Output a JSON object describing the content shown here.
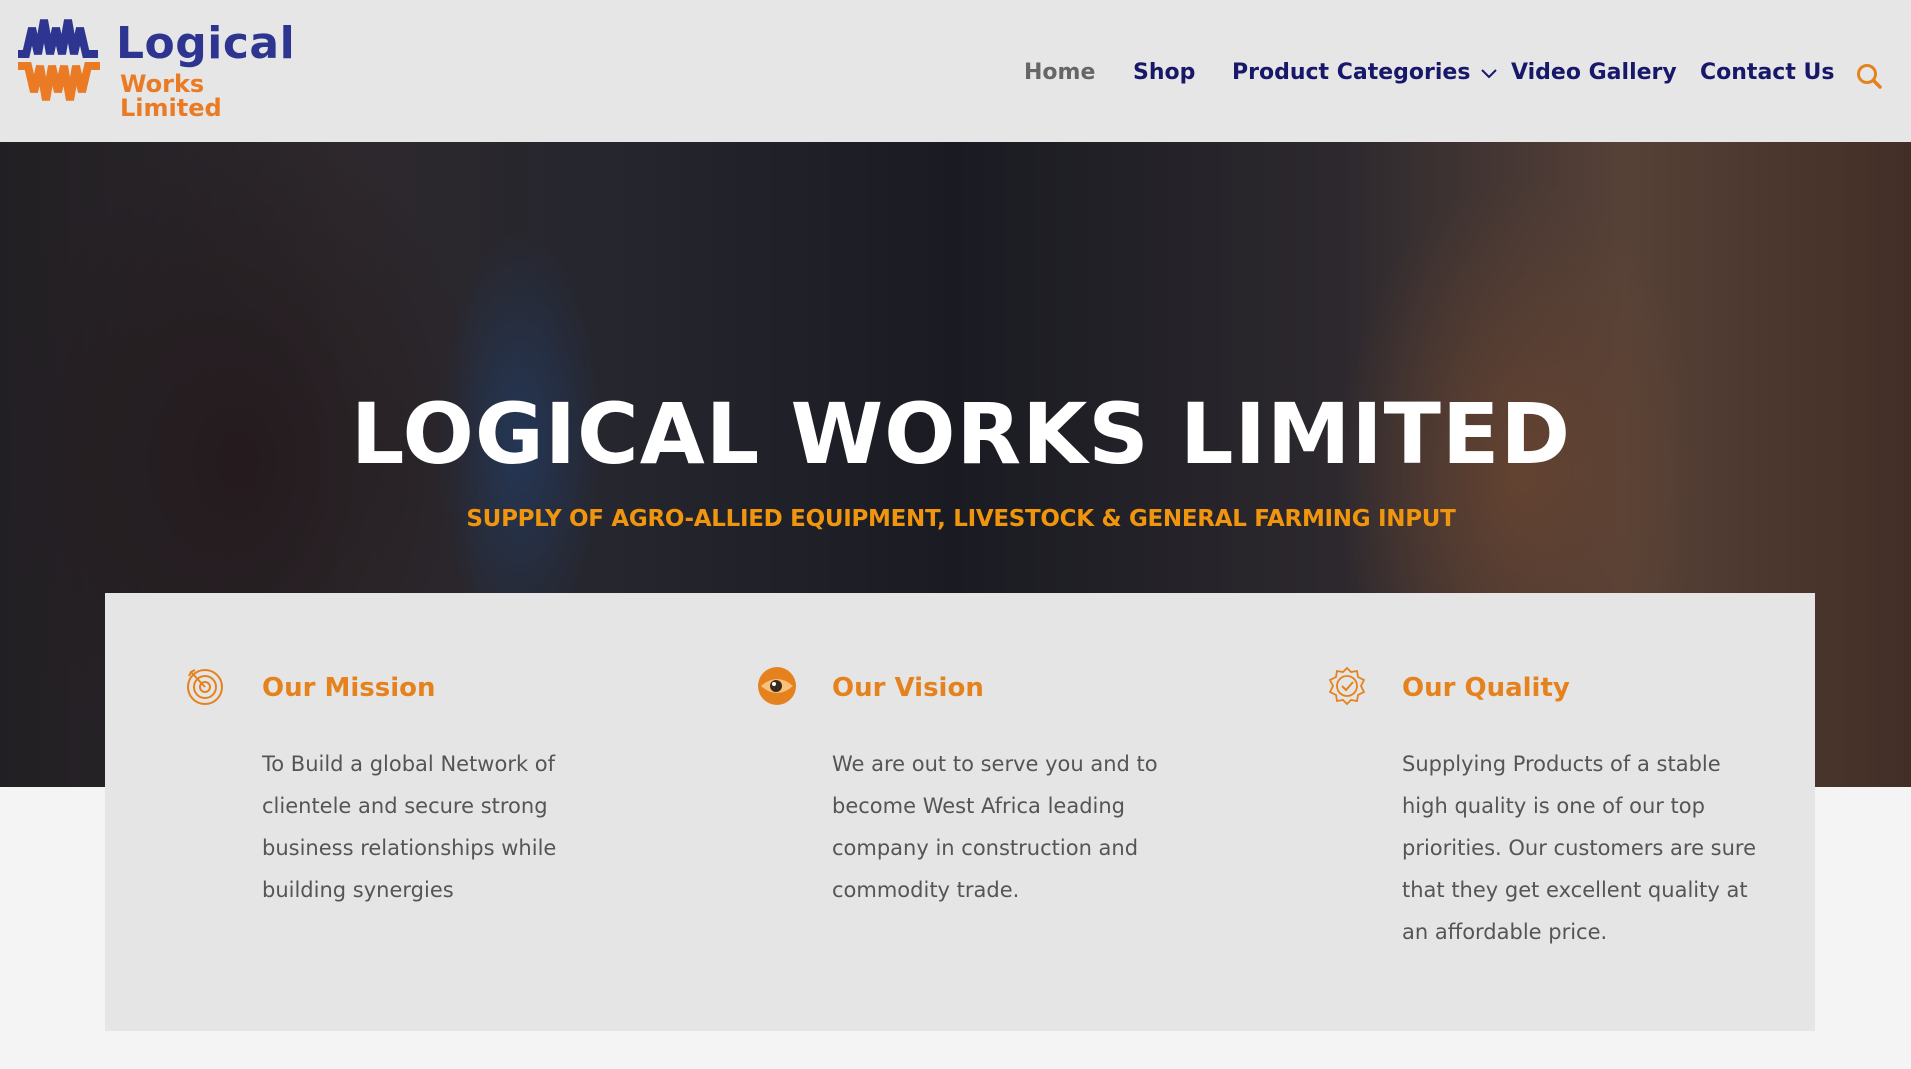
{
  "brand": {
    "line1": "Logical",
    "line2": "Works Limited",
    "colors": {
      "blue": "#2d3591",
      "orange": "#ea7a24"
    }
  },
  "nav": {
    "items": [
      {
        "label": "Home",
        "active": true
      },
      {
        "label": "Shop"
      },
      {
        "label": "Product Categories",
        "has_dropdown": true
      },
      {
        "label": "Video Gallery"
      },
      {
        "label": "Contact Us"
      }
    ],
    "search_icon": "search-icon"
  },
  "hero": {
    "title": "LOGICAL WORKS LIMITED",
    "subtitle": "SUPPLY OF AGRO-ALLIED EQUIPMENT, LIVESTOCK & GENERAL FARMING INPUT"
  },
  "features": [
    {
      "icon": "target-icon",
      "title": "Our Mission",
      "text": "To Build a global Network of clientele and secure strong business relationships while building synergies"
    },
    {
      "icon": "eye-icon",
      "title": "Our Vision",
      "text": "We are out to serve you and to become West Africa leading company in construction and commodity trade."
    },
    {
      "icon": "quality-badge-icon",
      "title": "Our Quality",
      "text": "Supplying Products of a stable high quality is one of our top priorities. Our customers are sure that they get excellent quality at an affordable price."
    }
  ],
  "colors": {
    "accent_orange": "#e5821d",
    "nav_blue": "#17186a",
    "header_bg": "#e6e6e6",
    "panel_bg": "#e5e5e5"
  }
}
